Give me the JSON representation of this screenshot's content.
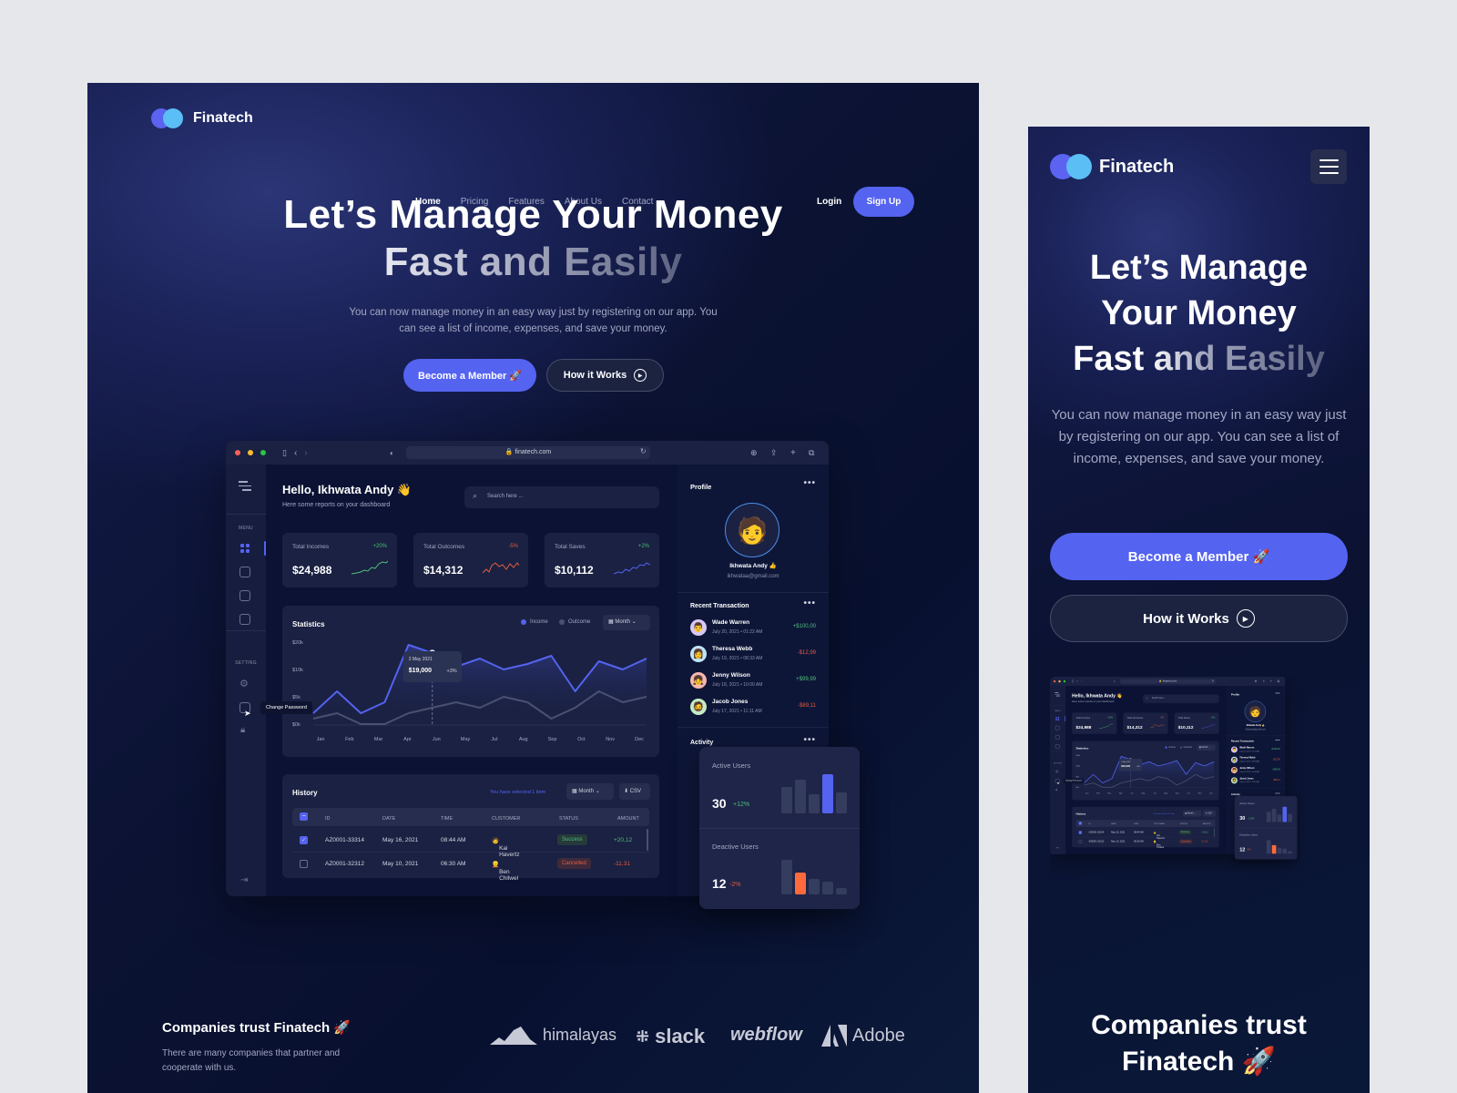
{
  "brand": {
    "name": "Finatech"
  },
  "nav": {
    "items": [
      "Home",
      "Pricing",
      "Features",
      "About Us",
      "Contact"
    ],
    "active": "Home",
    "login": "Login",
    "signup": "Sign Up"
  },
  "hero": {
    "line1": "Let’s Manage Your Money",
    "line2": "Fast and Easily",
    "mobile_line1": "Let’s Manage",
    "mobile_line2": "Your Money",
    "subtitle": "You can now manage money in an easy way just by registering on our app. You can see a list of income, expenses, and save your money.",
    "primary_btn": "Become a Member 🚀",
    "secondary_btn": "How it Works"
  },
  "browser": {
    "url": "finatech.com"
  },
  "dashboard": {
    "greeting": "Hello, Ikhwata Andy 👋",
    "greeting_sub": "Here some reports on your dashboard",
    "search_placeholder": "Search here ...",
    "sidebar": {
      "menu_label": "MENU",
      "setting_label": "SETTING",
      "tooltip": "Change Password"
    },
    "stats": [
      {
        "label": "Total Incomes",
        "value": "$24,988",
        "change": "+20%",
        "trend": "up"
      },
      {
        "label": "Total Outcomes",
        "value": "$14,312",
        "change": "-5%",
        "trend": "down"
      },
      {
        "label": "Total Saves",
        "value": "$10,112",
        "change": "+2%",
        "trend": "up"
      }
    ],
    "statistics": {
      "title": "Statistics",
      "legend_income": "Income",
      "legend_outcome": "Outcome",
      "period": "Month",
      "tooltip_date": "2 May 2021",
      "tooltip_value": "$19,000",
      "tooltip_change": "+3%"
    },
    "history": {
      "title": "History",
      "selected_text": "You have selected 1 item",
      "period": "Month",
      "export": "CSV",
      "columns": [
        "ID",
        "DATE",
        "TIME",
        "CUSTOMER",
        "STATUS",
        "AMOUNT"
      ],
      "rows": [
        {
          "checked": true,
          "id": "AZ0001-33314",
          "date": "May 16, 2021",
          "time": "08:44 AM",
          "customer": "Kai Havertz",
          "status": "Success",
          "amount": "+20,12"
        },
        {
          "checked": false,
          "id": "AZ0001-32312",
          "date": "May 10, 2021",
          "time": "06:30 AM",
          "customer": "Ben Chilwel",
          "status": "Cancelled",
          "amount": "-11,31"
        }
      ]
    },
    "profile": {
      "title": "Profile",
      "name": "Ikhwata Andy 👍",
      "email": "ikhwataa@gmail.com"
    },
    "recent": {
      "title": "Recent Transaction",
      "items": [
        {
          "name": "Wade Warren",
          "date": "July 20, 2021 • 01:22 AM",
          "amount": "+$100,00",
          "positive": true
        },
        {
          "name": "Theresa Webb",
          "date": "July 19, 2021 • 08:33 AM",
          "amount": "-$12,99",
          "positive": false
        },
        {
          "name": "Jenny Wilson",
          "date": "July 18, 2021 • 10:00 AM",
          "amount": "+$99,99",
          "positive": true
        },
        {
          "name": "Jacob Jones",
          "date": "July 17, 2021 • 11:11 AM",
          "amount": "-$89,11",
          "positive": false
        }
      ]
    },
    "activity": {
      "title": "Activity",
      "active_label": "Active Users",
      "active_value": "30",
      "active_change": "+12%",
      "deactive_label": "Deactive Users",
      "deactive_value": "12",
      "deactive_change": "-2%"
    }
  },
  "chart_data": {
    "type": "line",
    "title": "Statistics",
    "categories": [
      "Jan",
      "Feb",
      "Mar",
      "Apr",
      "Jun",
      "May",
      "Jul",
      "Aug",
      "Sep",
      "Oct",
      "Nov",
      "Dec"
    ],
    "y_ticks": [
      "$0k",
      "$5k",
      "$10k",
      "$20k"
    ],
    "series": [
      {
        "name": "Income",
        "values": [
          2,
          6,
          2,
          4,
          19,
          16,
          11,
          14,
          10,
          12,
          15,
          6,
          13,
          10,
          14
        ]
      },
      {
        "name": "Outcome",
        "values": [
          1,
          2,
          0,
          0,
          2,
          3,
          4,
          3,
          5,
          4,
          1,
          3,
          6,
          4,
          5
        ]
      }
    ]
  },
  "trust": {
    "title": "Companies trust Finatech 🚀",
    "mobile_title_1": "Companies trust",
    "mobile_title_2": "Finatech 🚀",
    "subtitle": "There are many companies that partner and cooperate with us.",
    "logos": [
      "himalayas",
      "slack",
      "webflow",
      "Adobe"
    ]
  },
  "colors": {
    "accent": "#5463f0",
    "success": "#4fbf7a",
    "danger": "#e25c3f",
    "orange": "#ff6a3d"
  }
}
